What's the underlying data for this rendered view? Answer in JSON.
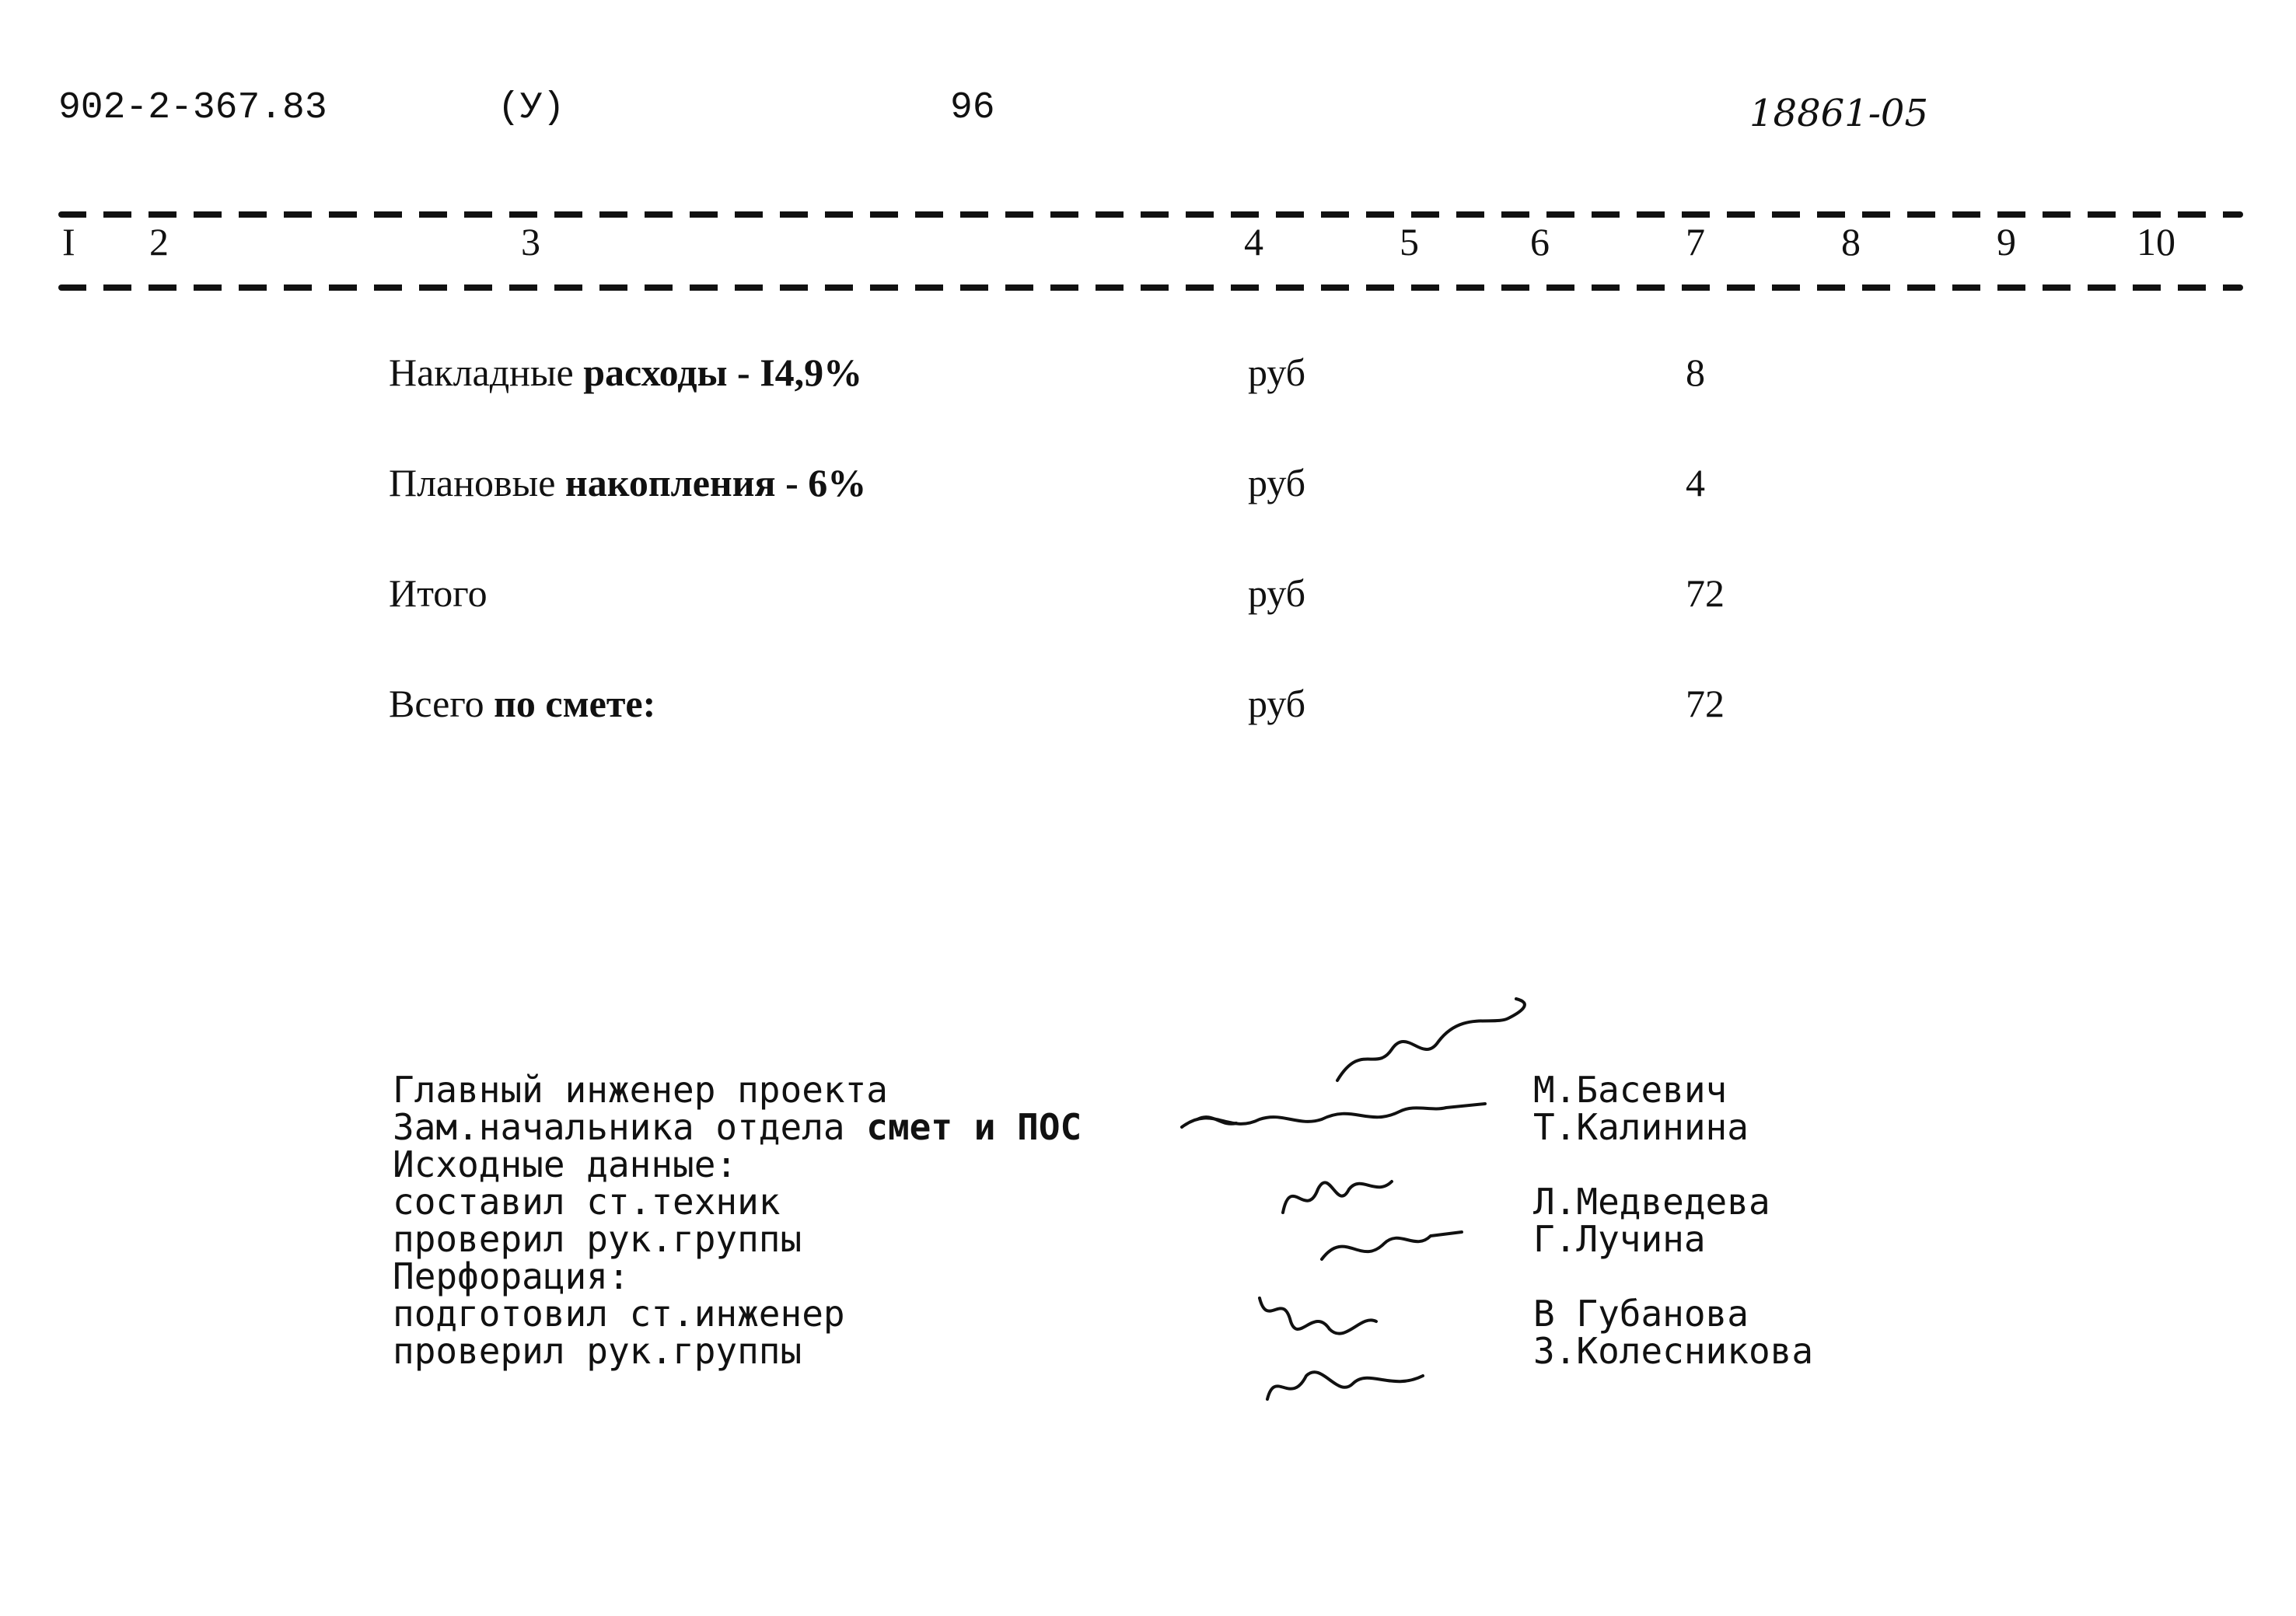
{
  "header": {
    "project_code": "902-2-367.83",
    "mark": "(У)",
    "page_number": "96",
    "archive_number": "18861-05"
  },
  "table": {
    "column_numbers": [
      "I",
      "2",
      "3",
      "4",
      "5",
      "6",
      "7",
      "8",
      "9",
      "10"
    ],
    "rows": [
      {
        "description_plain": "Накладные",
        "description_bold": "расходы - I4,9%",
        "unit": "руб",
        "value": "8"
      },
      {
        "description_plain": "Плановые",
        "description_bold": "накопления - 6%",
        "unit": "руб",
        "value": "4"
      },
      {
        "description_plain": "Итого",
        "description_bold": "",
        "unit": "руб",
        "value": "72"
      },
      {
        "description_plain": "Всего",
        "description_bold": "по смете:",
        "unit": "руб",
        "value": "72"
      }
    ]
  },
  "signatures": {
    "labels": [
      {
        "plain": "Главный инженер проекта",
        "bold": ""
      },
      {
        "plain": "Зам.начальника отдела",
        "bold": "смет и ПОС"
      },
      {
        "plain": "Исходные данные:",
        "bold": ""
      },
      {
        "plain": "составил ст.техник",
        "bold": ""
      },
      {
        "plain": "проверил рук.группы",
        "bold": ""
      },
      {
        "plain": "Перфорация:",
        "bold": ""
      },
      {
        "plain": "подготовил ст.инженер",
        "bold": ""
      },
      {
        "plain": "проверил рук.группы",
        "bold": ""
      }
    ],
    "names": [
      "М.Басевич",
      "Т.Калинина",
      "Л.Медведева",
      "Г.Лучина",
      "В Губанова",
      "З.Колесникова"
    ]
  }
}
